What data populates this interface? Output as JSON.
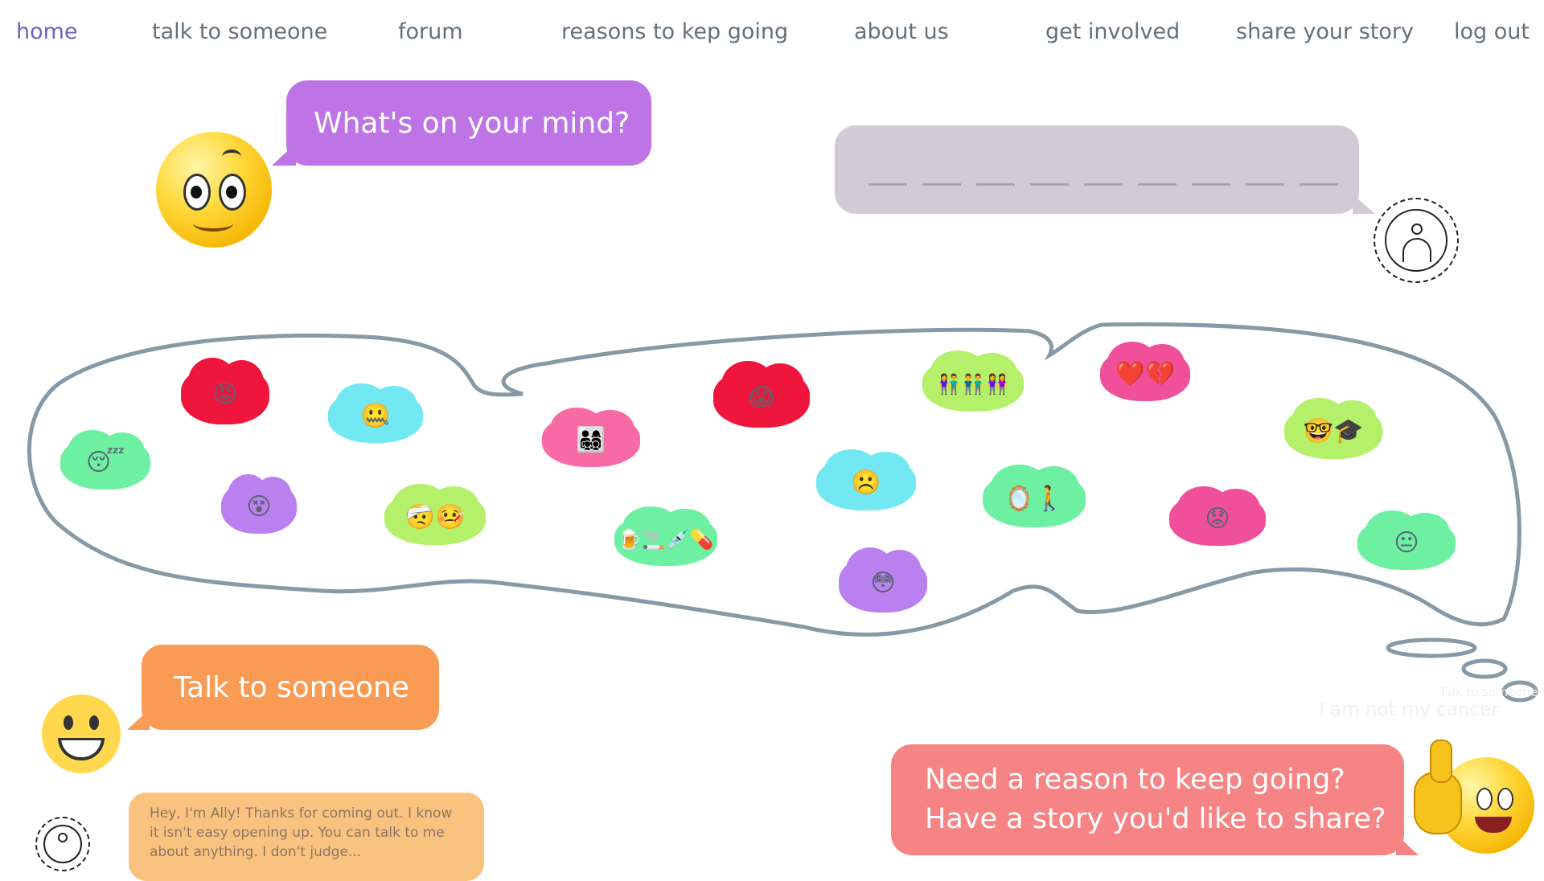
{
  "nav": {
    "items": [
      {
        "label": "home",
        "active": true
      },
      {
        "label": "talk to someone"
      },
      {
        "label": "forum"
      },
      {
        "label": "reasons to kep going"
      },
      {
        "label": "about us"
      },
      {
        "label": "get involved"
      },
      {
        "label": "share your story"
      },
      {
        "label": "log out"
      }
    ]
  },
  "prompt": {
    "text": "What's on your mind?"
  },
  "input": {
    "placeholder": ""
  },
  "talk": {
    "label": "Talk to someone"
  },
  "ally": {
    "text": "Hey, I'm Ally! Thanks for coming out. I know it isn't easy opening up. You can talk to me about anything. I don't judge..."
  },
  "reason": {
    "line1": "Need a reason to keep going?",
    "line2": "Have a story you'd like to share?"
  },
  "faint": {
    "line1": "Talk to someone",
    "line2": "I am not my cancer"
  },
  "clouds": [
    {
      "icon": "sleepy-face-icon",
      "glyph": "😴",
      "color": "green"
    },
    {
      "icon": "angry-face-icon",
      "glyph": "😡",
      "color": "red"
    },
    {
      "icon": "zipper-mouth-face-icon",
      "glyph": "🤐",
      "color": "cyan"
    },
    {
      "icon": "dizzy-face-icon",
      "glyph": "😵",
      "color": "purple"
    },
    {
      "icon": "injured-sick-faces-icon",
      "glyph": "🤕🤒",
      "color": "lime"
    },
    {
      "icon": "family-icon",
      "glyph": "👨‍👩‍👧‍👦",
      "color": "pink"
    },
    {
      "icon": "substances-icon",
      "glyph": "🍺🚬💉💊",
      "color": "green"
    },
    {
      "icon": "screaming-face-icon",
      "glyph": "😱",
      "color": "red"
    },
    {
      "icon": "frowning-face-icon",
      "glyph": "☹️",
      "color": "cyan"
    },
    {
      "icon": "worried-face-icon",
      "glyph": "😳",
      "color": "purple"
    },
    {
      "icon": "group-of-people-icon",
      "glyph": "👫👬👭",
      "color": "lime"
    },
    {
      "icon": "mirror-silhouette-icon",
      "glyph": "🪞🚶",
      "color": "green"
    },
    {
      "icon": "broken-heart-icon",
      "glyph": "❤️💔",
      "color": "mag"
    },
    {
      "icon": "graduate-face-icon",
      "glyph": "🤓🎓",
      "color": "lime"
    },
    {
      "icon": "anxious-face-icon",
      "glyph": "😟",
      "color": "mag"
    },
    {
      "icon": "neutral-face-icon",
      "glyph": "😐",
      "color": "green"
    }
  ]
}
